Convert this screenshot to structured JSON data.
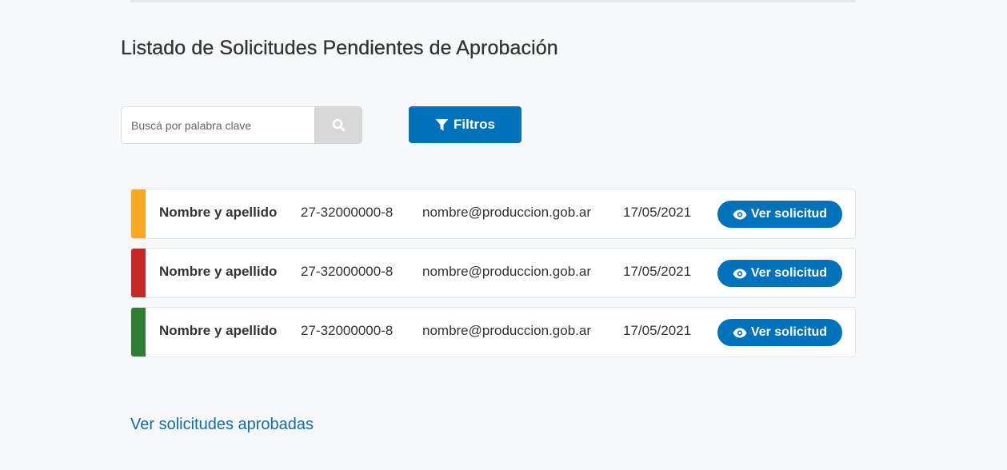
{
  "page": {
    "title": "Listado de Solicitudes Pendientes de Aprobación"
  },
  "search": {
    "placeholder": "Buscá por palabra clave",
    "value": "",
    "button_icon": "search-icon"
  },
  "filters": {
    "label": "Filtros",
    "icon": "filter-icon"
  },
  "requests": [
    {
      "status_color": "#f9a822",
      "name": "Nombre y apellido",
      "cuit": "27-32000000-8",
      "email": "nombre@produccion.gob.ar",
      "date": "17/05/2021",
      "action_label": "Ver solicitud",
      "action_icon": "eye-icon"
    },
    {
      "status_color": "#c62828",
      "name": "Nombre y apellido",
      "cuit": "27-32000000-8",
      "email": "nombre@produccion.gob.ar",
      "date": "17/05/2021",
      "action_label": "Ver solicitud",
      "action_icon": "eye-icon"
    },
    {
      "status_color": "#2e7d32",
      "name": "Nombre y apellido",
      "cuit": "27-32000000-8",
      "email": "nombre@produccion.gob.ar",
      "date": "17/05/2021",
      "action_label": "Ver solicitud",
      "action_icon": "eye-icon"
    }
  ],
  "footer": {
    "approved_link": "Ver solicitudes aprobadas"
  },
  "colors": {
    "primary": "#0072bb",
    "link": "#0a6cb2",
    "background": "#f7f8fa"
  }
}
